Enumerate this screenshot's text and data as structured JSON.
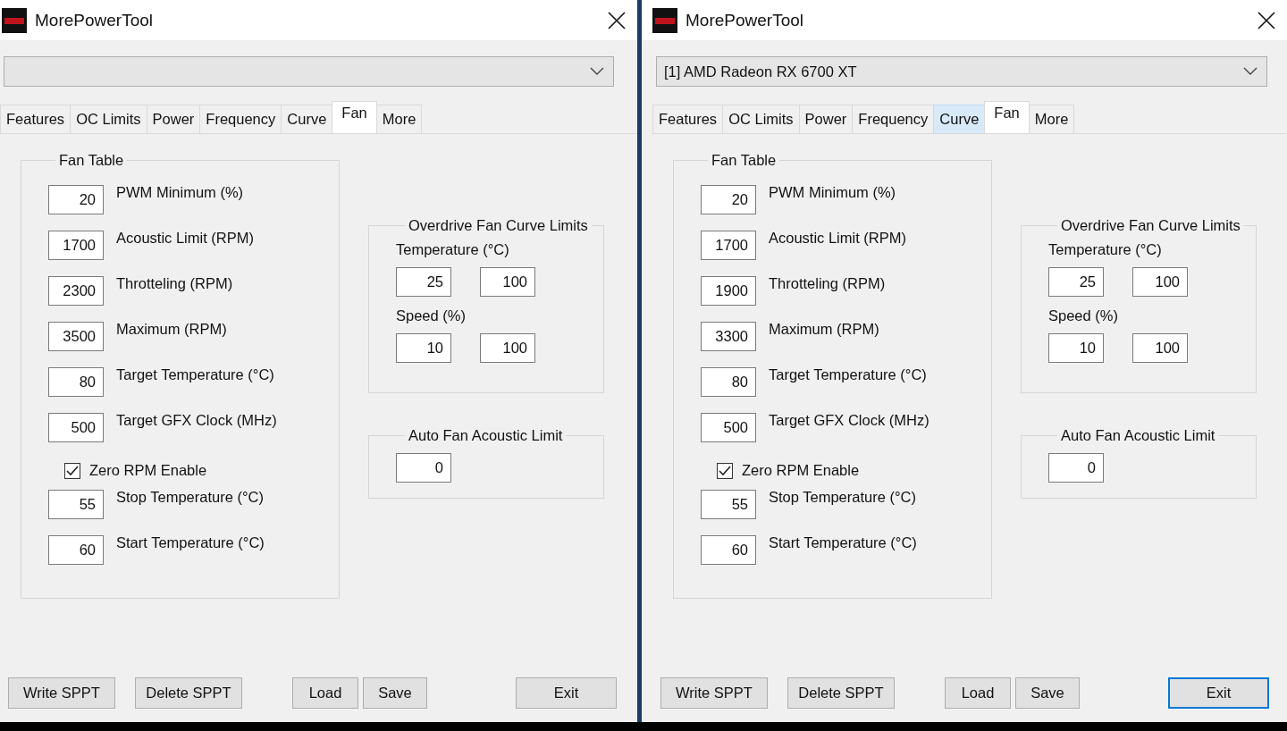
{
  "windows": [
    {
      "title": "MorePowerTool",
      "tabs": [
        {
          "label": "Features",
          "selected": false,
          "hovered": false
        },
        {
          "label": "OC Limits",
          "selected": false,
          "hovered": false
        },
        {
          "label": "Power",
          "selected": false,
          "hovered": false
        },
        {
          "label": "Frequency",
          "selected": false,
          "hovered": false
        },
        {
          "label": "Curve",
          "selected": false,
          "hovered": false
        },
        {
          "label": "Fan",
          "selected": true,
          "hovered": false
        },
        {
          "label": "More",
          "selected": false,
          "hovered": false
        }
      ],
      "fan_table": {
        "title": "Fan Table",
        "rows": [
          {
            "kind": "field",
            "value": "20",
            "label": "PWM Minimum (%)"
          },
          {
            "kind": "field",
            "value": "1700",
            "label": "Acoustic Limit (RPM)"
          },
          {
            "kind": "field",
            "value": "2300",
            "label": "Throtteling (RPM)"
          },
          {
            "kind": "field",
            "value": "3500",
            "label": "Maximum (RPM)"
          },
          {
            "kind": "field",
            "value": "80",
            "label": "Target Temperature (°C)"
          },
          {
            "kind": "field",
            "value": "500",
            "label": "Target GFX Clock (MHz)"
          },
          {
            "kind": "checkbox",
            "label": "Zero RPM Enable",
            "checked": true
          },
          {
            "kind": "field",
            "value": "55",
            "label": "Stop Temperature (°C)"
          },
          {
            "kind": "field",
            "value": "60",
            "label": "Start Temperature (°C)"
          }
        ]
      },
      "overdrive": {
        "title": "Overdrive Fan Curve Limits",
        "temperature_label": "Temperature (°C)",
        "temperature": [
          "25",
          "100"
        ],
        "speed_label": "Speed (%)",
        "speed": [
          "10",
          "100"
        ]
      },
      "auto_fan": {
        "title": "Auto Fan Acoustic Limit",
        "value": "0"
      },
      "buttons": [
        {
          "label": "Write SPPT",
          "focused": false
        },
        {
          "label": "Delete SPPT",
          "focused": false
        },
        {
          "label": "Load",
          "focused": false
        },
        {
          "label": "Save",
          "focused": false
        },
        {
          "label": "Exit",
          "focused": false
        }
      ]
    },
    {
      "title": "MorePowerTool",
      "device": "[1] AMD Radeon RX 6700 XT",
      "tabs": [
        {
          "label": "Features",
          "selected": false,
          "hovered": false
        },
        {
          "label": "OC Limits",
          "selected": false,
          "hovered": false
        },
        {
          "label": "Power",
          "selected": false,
          "hovered": false
        },
        {
          "label": "Frequency",
          "selected": false,
          "hovered": false
        },
        {
          "label": "Curve",
          "selected": false,
          "hovered": true
        },
        {
          "label": "Fan",
          "selected": true,
          "hovered": false
        },
        {
          "label": "More",
          "selected": false,
          "hovered": false
        }
      ],
      "fan_table": {
        "title": "Fan Table",
        "rows": [
          {
            "kind": "field",
            "value": "20",
            "label": "PWM Minimum (%)"
          },
          {
            "kind": "field",
            "value": "1700",
            "label": "Acoustic Limit (RPM)"
          },
          {
            "kind": "field",
            "value": "1900",
            "label": "Throtteling (RPM)"
          },
          {
            "kind": "field",
            "value": "3300",
            "label": "Maximum (RPM)"
          },
          {
            "kind": "field",
            "value": "80",
            "label": "Target Temperature (°C)"
          },
          {
            "kind": "field",
            "value": "500",
            "label": "Target GFX Clock (MHz)"
          },
          {
            "kind": "checkbox",
            "label": "Zero RPM Enable",
            "checked": true
          },
          {
            "kind": "field",
            "value": "55",
            "label": "Stop Temperature (°C)"
          },
          {
            "kind": "field",
            "value": "60",
            "label": "Start Temperature (°C)"
          }
        ]
      },
      "overdrive": {
        "title": "Overdrive Fan Curve Limits",
        "temperature_label": "Temperature (°C)",
        "temperature": [
          "25",
          "100"
        ],
        "speed_label": "Speed (%)",
        "speed": [
          "10",
          "100"
        ]
      },
      "auto_fan": {
        "title": "Auto Fan Acoustic Limit",
        "value": "0"
      },
      "buttons": [
        {
          "label": "Write SPPT",
          "focused": false
        },
        {
          "label": "Delete SPPT",
          "focused": false
        },
        {
          "label": "Load",
          "focused": false
        },
        {
          "label": "Save",
          "focused": false
        },
        {
          "label": "Exit",
          "focused": true
        }
      ]
    }
  ]
}
